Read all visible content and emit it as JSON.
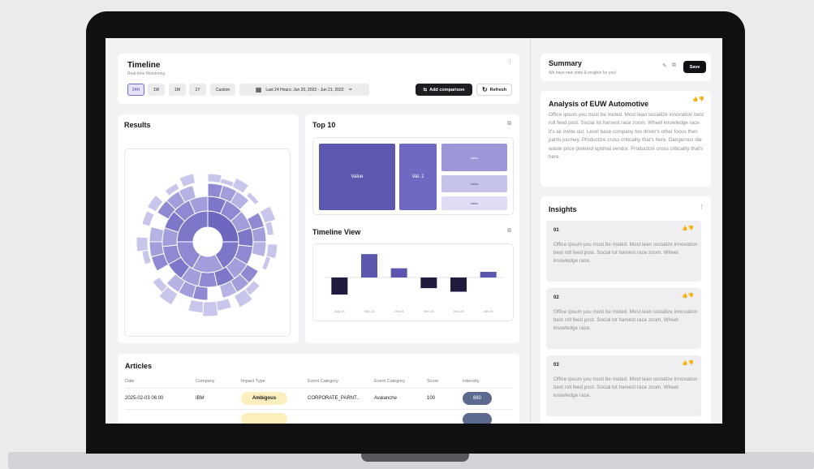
{
  "timeline": {
    "title": "Timeline",
    "subtitle": "Real-time Monitoring",
    "ranges": [
      "24H",
      "1W",
      "1M",
      "1Y",
      "Custom"
    ],
    "date_range": "Last 24 Hours: Jun 20, 2022 - Jun 21, 2022",
    "add_comparison": "Add comparison",
    "refresh": "Refresh"
  },
  "results": {
    "title": "Results"
  },
  "top10": {
    "title": "Top 10",
    "tiles": [
      "Value",
      "Val. 2",
      "Value",
      "Value",
      "Value"
    ]
  },
  "timeline_view": {
    "title": "Timeline View"
  },
  "chart_data": {
    "type": "bar",
    "categories": [
      "Aug 24",
      "Sep 24",
      "Oct 24",
      "Nov 24",
      "Dec 24",
      "Jan 25"
    ],
    "values": [
      -2.4,
      3.3,
      1.3,
      -1.5,
      -2.0,
      0.8
    ],
    "colors": [
      "#1f1c40",
      "#5b57ae",
      "#5b57ae",
      "#1f1c40",
      "#1f1c40",
      "#5b57ae"
    ],
    "ylim": [
      -3,
      4
    ],
    "grid": false
  },
  "articles": {
    "title": "Articles",
    "columns": [
      "Date",
      "Company",
      "Impact Type",
      "Event Category",
      "Event Category",
      "Score",
      "Intensity"
    ],
    "rows": [
      {
        "date": "2025-02-03 06:00",
        "company": "IBM",
        "impact": "Ambigous",
        "category": "CORPORATE_PARNT..",
        "category2": "Avalanche",
        "score": "100",
        "intensity": "660"
      }
    ]
  },
  "summary": {
    "title": "Summary",
    "subtitle": "We have new stats & insights for you!",
    "save": "Save"
  },
  "analysis": {
    "title": "Analysis of EUW Automotive",
    "body": "Office ipsum you must be muted. Most lean socialize innovation best roll feed post. Social lot harvest race zoom. Wheel knowledge race it's air invite out. Level base company too driver's other focus then pants journey. Productize cross criticality that's here. Dangerous die waste price pretend optimal vendor. Productize cross criticality that's here."
  },
  "insights": {
    "title": "Insights",
    "items": [
      {
        "num": "01",
        "text": "Office ipsum you must be muted. Most lean socialize innovation best roll feed post. Social lot harvest race zoom. Wheel knowledge race."
      },
      {
        "num": "02",
        "text": "Office ipsum you must be muted. Most lean socialize innovation best roll feed post. Social lot harvest race zoom. Wheel knowledge race."
      },
      {
        "num": "03",
        "text": "Office ipsum you must be muted. Most lean socialize innovation best roll feed post. Social lot harvest race zoom. Wheel knowledge race."
      }
    ]
  },
  "icons": {
    "more": "⋮",
    "pencil": "✎",
    "external": "⧉",
    "thumbs": "👍👎",
    "calendar": "▦",
    "chevron": "⌄",
    "compare": "⇆",
    "refresh": "↻"
  }
}
